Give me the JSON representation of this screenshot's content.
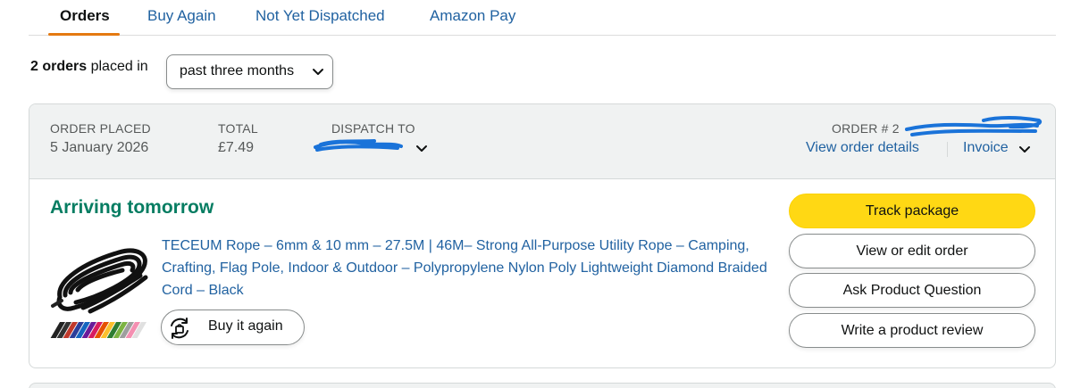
{
  "tabs": [
    {
      "label": "Orders",
      "active": true
    },
    {
      "label": "Buy Again",
      "active": false
    },
    {
      "label": "Not Yet Dispatched",
      "active": false
    },
    {
      "label": "Amazon Pay",
      "active": false
    }
  ],
  "filter": {
    "count_text": "2 orders",
    "suffix_text": "placed in",
    "selected_period": "past three months"
  },
  "order": {
    "placed_label": "ORDER PLACED",
    "placed_value": "5 January 2026",
    "total_label": "TOTAL",
    "total_value": "£7.49",
    "dispatch_label": "DISPATCH TO",
    "order_number_label": "ORDER # 2",
    "view_details_label": "View order details",
    "invoice_label": "Invoice",
    "status": "Arriving tomorrow",
    "product_title": "TECEUM Rope – 6mm & 10 mm – 27.5M | 46M– Strong All-Purpose Utility Rope – Camping, Crafting, Flag Pole, Indoor & Outdoor – Polypropylene Nylon Poly Lightweight Diamond Braided Cord – Black",
    "buy_again_label": "Buy it again",
    "actions": {
      "track": "Track package",
      "view_edit": "View or edit order",
      "ask_question": "Ask Product Question",
      "write_review": "Write a product review"
    }
  },
  "colors": {
    "link": "#2162a1",
    "status_green": "#067d62",
    "primary_button": "#ffd814",
    "tab_underline": "#e47911",
    "redaction_scribble": "#1a73d9"
  },
  "icons": [
    "chevron-down-icon",
    "buy-again-cycle-icon",
    "rope-product-image"
  ]
}
